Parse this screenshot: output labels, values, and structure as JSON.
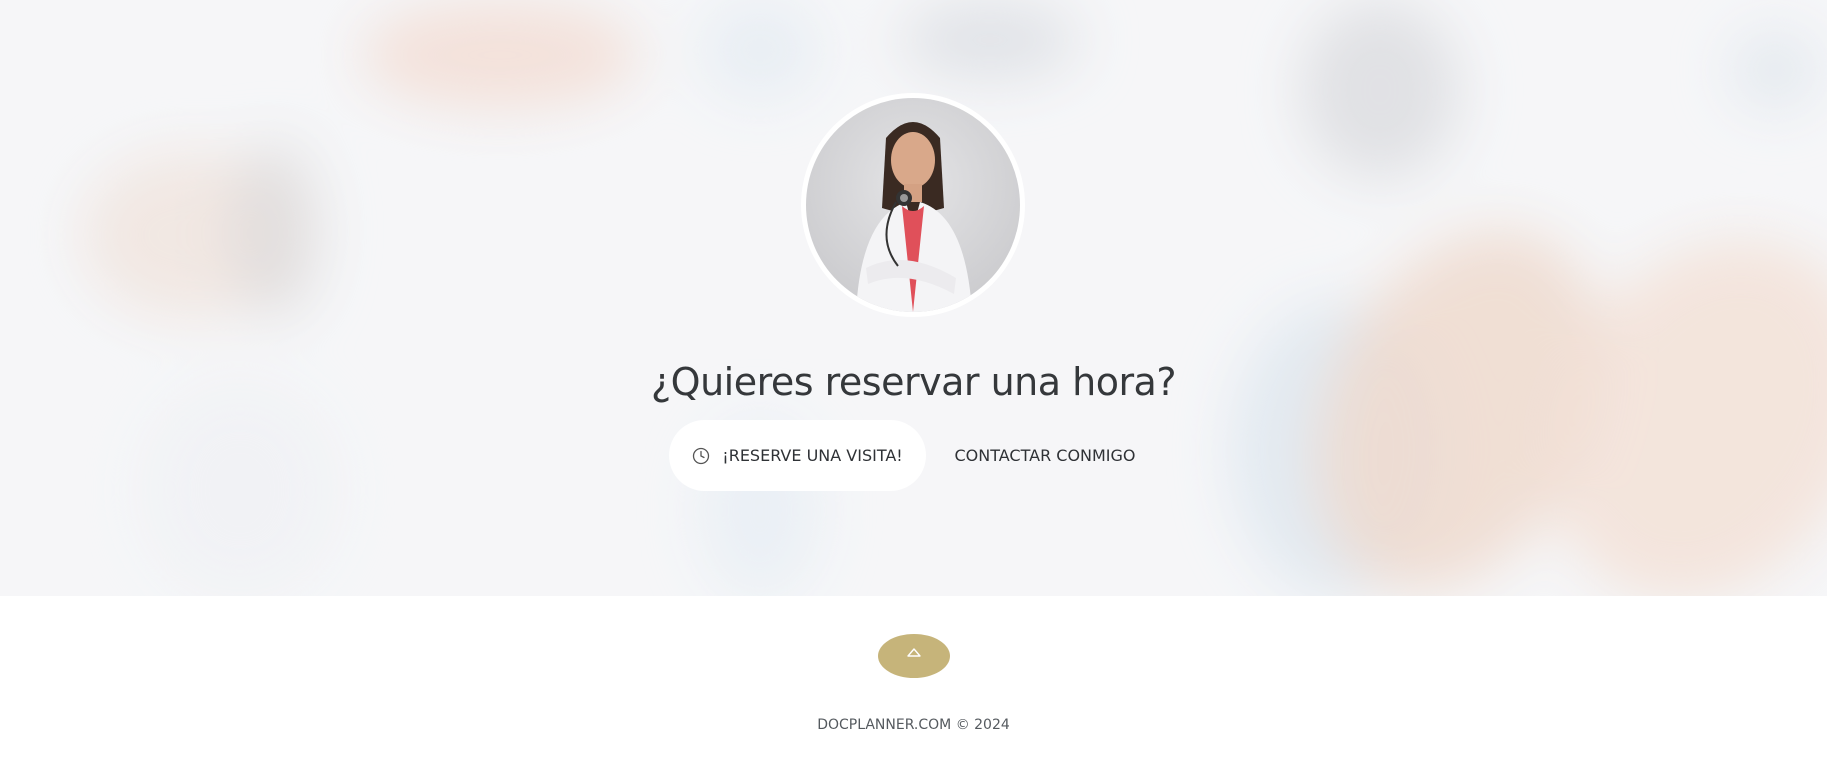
{
  "hero": {
    "headline": "¿Quieres reservar una hora?",
    "book_button_label": "¡RESERVE UNA VISITA!",
    "book_button_icon": "clock-icon",
    "contact_button_label": "CONTACTAR CONMIGO"
  },
  "scroll_top": {
    "icon": "chevron-up-icon",
    "color": "#c6b47a"
  },
  "footer": {
    "brand": "DOCPLANNER.COM",
    "copyright": "© 2024"
  },
  "colors": {
    "accent": "#c6b47a",
    "text": "#35383b"
  }
}
